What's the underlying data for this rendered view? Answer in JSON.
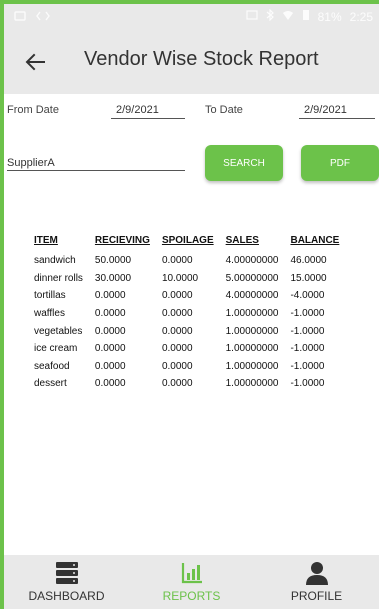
{
  "status_bar": {
    "battery": "81%",
    "time": "2:25"
  },
  "app_bar": {
    "title": "Vendor Wise Stock Report"
  },
  "filters": {
    "from_label": "From Date",
    "from_value": "2/9/2021",
    "to_label": "To Date",
    "to_value": "2/9/2021",
    "supplier_value": "SupplierA",
    "search_label": "SEARCH",
    "pdf_label": "PDF"
  },
  "table": {
    "headers": [
      "ITEM",
      "RECIEVING",
      "SPOILAGE",
      "SALES",
      "BALANCE"
    ],
    "rows": [
      [
        "sandwich",
        "50.0000",
        "0.0000",
        "4.00000000",
        "46.0000"
      ],
      [
        "dinner rolls",
        "30.0000",
        "10.0000",
        "5.00000000",
        "15.0000"
      ],
      [
        "tortillas",
        "0.0000",
        "0.0000",
        "4.00000000",
        "-4.0000"
      ],
      [
        "waffles",
        "0.0000",
        "0.0000",
        "1.00000000",
        "-1.0000"
      ],
      [
        "vegetables",
        "0.0000",
        "0.0000",
        "1.00000000",
        "-1.0000"
      ],
      [
        "ice cream",
        "0.0000",
        "0.0000",
        "1.00000000",
        "-1.0000"
      ],
      [
        "seafood",
        "0.0000",
        "0.0000",
        "1.00000000",
        "-1.0000"
      ],
      [
        "dessert",
        "0.0000",
        "0.0000",
        "1.00000000",
        "-1.0000"
      ]
    ]
  },
  "bottom_nav": {
    "dashboard": "DASHBOARD",
    "reports": "REPORTS",
    "profile": "PROFILE"
  },
  "colors": {
    "accent": "#6cc24a",
    "bar": "#e9e9e9"
  },
  "icons": {
    "back": "arrow-left-icon",
    "dashboard": "server-stack-icon",
    "reports": "bar-chart-icon",
    "profile": "person-icon"
  }
}
